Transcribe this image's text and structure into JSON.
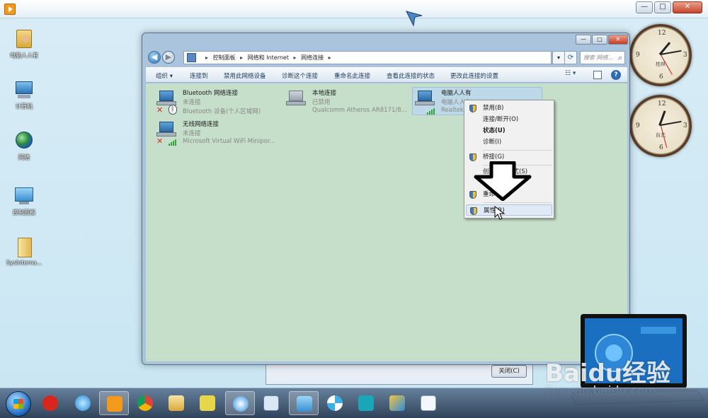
{
  "desktop": {
    "icons": [
      {
        "label": "电脑人人有"
      },
      {
        "label": "计算机"
      },
      {
        "label": "网络"
      },
      {
        "label": "控制面板"
      },
      {
        "label": "SysInterna..."
      }
    ],
    "clocks": [
      {
        "city": "桂林"
      },
      {
        "city": "台北"
      }
    ]
  },
  "outer_window": {
    "min_label": "—",
    "max_label": "□",
    "close_label": "✕"
  },
  "explorer": {
    "title_controls": {
      "min": "—",
      "max": "□",
      "close": "✕"
    },
    "back_label": "◀",
    "forward_label": "▶",
    "address": {
      "crumbs": [
        "控制面板",
        "网络和 Internet",
        "网络连接"
      ]
    },
    "search_placeholder": "搜索 网络...",
    "toolbar": {
      "organize": "组织 ▾",
      "connect_to": "连接到",
      "disable": "禁用此网络设备",
      "diagnose": "诊断这个连接",
      "rename": "重命名此连接",
      "view_status": "查看此连接的状态",
      "change_settings": "更改此连接的设置",
      "help": "?"
    },
    "connections": [
      {
        "name": "Bluetooth 网络连接",
        "status": "未连接",
        "device": "Bluetooth 设备(个人区域网)"
      },
      {
        "name": "本地连接",
        "status": "已禁用",
        "device": "Qualcomm Atheros AR8171/8..."
      },
      {
        "name": "电脑人人有",
        "status": "电脑人人有",
        "device": "Realtek..."
      },
      {
        "name": "无线网络连接",
        "status": "未连接",
        "device": "Microsoft Virtual WiFi Minipor..."
      }
    ]
  },
  "context_menu": {
    "items": [
      {
        "label": "禁用(B)"
      },
      {
        "label": "连接/断开(O)"
      },
      {
        "label": "状态(U)"
      },
      {
        "label": "诊断(I)"
      },
      {
        "label": "桥接(G)"
      },
      {
        "label": "创建快捷方式(S)"
      },
      {
        "label": "重命名(M)"
      },
      {
        "label": "属性(R)"
      }
    ]
  },
  "dialog_behind": {
    "close_button": "关闭(C)"
  },
  "watermark": {
    "logo": "Baidu经验",
    "url": "jingyan.baidu.com"
  },
  "colors": {
    "content_bg": "#c6dfca",
    "menu_highlight": "#dfeaf6",
    "error_red": "#d62a1a",
    "signal_green": "#35a33a"
  }
}
